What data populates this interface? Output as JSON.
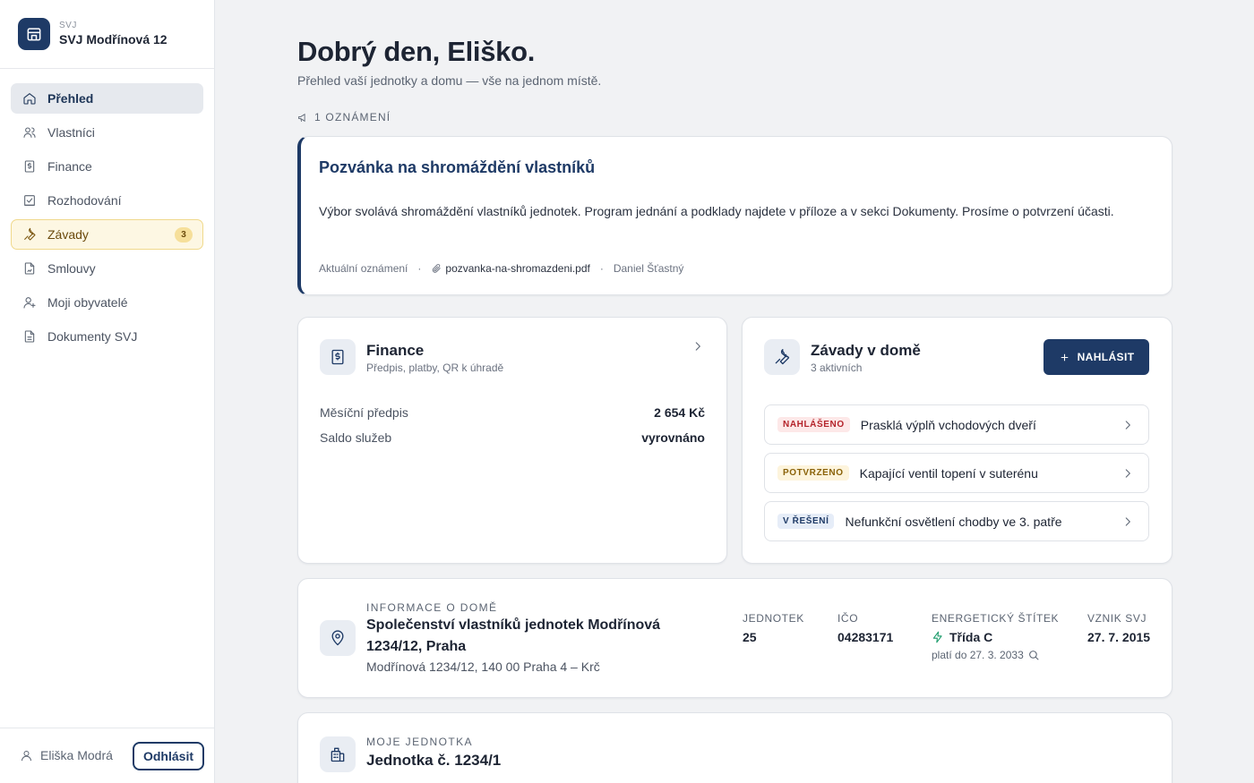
{
  "sidebar": {
    "brand_small": "SVJ",
    "brand_name": "SVJ Modřínová 12",
    "items": [
      {
        "label": "Přehled"
      },
      {
        "label": "Vlastníci"
      },
      {
        "label": "Finance"
      },
      {
        "label": "Rozhodování"
      },
      {
        "label": "Závady",
        "badge": "3"
      },
      {
        "label": "Smlouvy"
      },
      {
        "label": "Moji obyvatelé"
      },
      {
        "label": "Dokumenty SVJ"
      }
    ],
    "user_name": "Eliška Modrá",
    "logout_label": "Odhlásit"
  },
  "header": {
    "title": "Dobrý den, Eliško.",
    "subtitle": "Přehled vaší jednotky a domu — vše na jednom místě."
  },
  "announcements": {
    "label": "1 OZNÁMENÍ",
    "title": "Pozvánka na shromáždění vlastníků",
    "body": "Výbor svolává shromáždění vlastníků jednotek. Program jednání a podklady najdete v příloze a v sekci Dokumenty. Prosíme o potvrzení účasti.",
    "category": "Aktuální oznámení",
    "attachment": "pozvanka-na-shromazdeni.pdf",
    "author": "Daniel Šťastný"
  },
  "finance": {
    "title": "Finance",
    "subtitle": "Předpis, platby, QR k úhradě",
    "rows": [
      {
        "label": "Měsíční předpis",
        "value": "2 654 Kč"
      },
      {
        "label": "Saldo služeb",
        "value": "vyrovnáno"
      }
    ]
  },
  "defects": {
    "title": "Závady v domě",
    "subtitle": "3 aktivních",
    "report_label": "NAHLÁSIT",
    "items": [
      {
        "status": "NAHLÁŠENO",
        "text": "Prasklá výplň vchodových dveří",
        "color": "#b4232a"
      },
      {
        "status": "POTVRZENO",
        "text": "Kapající ventil topení v suterénu",
        "color": "#8a6209"
      },
      {
        "status": "V ŘEŠENÍ",
        "text": "Nefunkční osvětlení chodby ve 3. patře",
        "color": "#1e3a66"
      }
    ]
  },
  "house_info": {
    "eyebrow": "INFORMACE O DOMĚ",
    "title": "Společenství vlastníků jednotek Modřínová 1234/12, Praha",
    "address": "Modřínová 1234/12, 140 00 Praha 4 – Krč",
    "units_label": "JEDNOTEK",
    "units_value": "25",
    "ico_label": "IČO",
    "ico_value": "04283171",
    "energy_label": "ENERGETICKÝ ŠTÍTEK",
    "energy_value": "Třída C",
    "energy_valid": "platí do 27. 3. 2033",
    "founded_label": "VZNIK SVJ",
    "founded_value": "27. 7. 2015"
  },
  "my_unit": {
    "eyebrow": "MOJE JEDNOTKA",
    "title": "Jednotka č. 1234/1"
  },
  "colors": {
    "brand": "#1e3a66",
    "warning": "#f0d98c",
    "energy": "#1a9b6a"
  }
}
